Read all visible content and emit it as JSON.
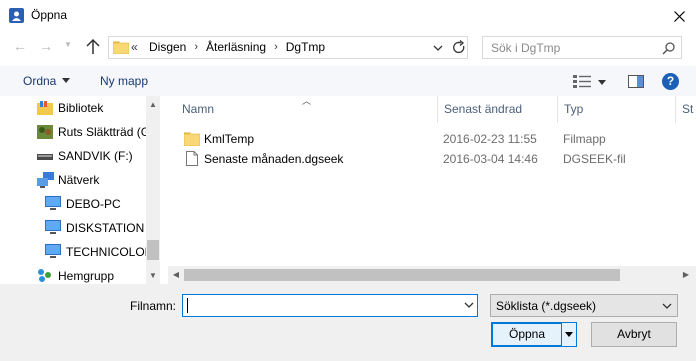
{
  "window": {
    "title": "Öppna"
  },
  "address": {
    "overflow": "«",
    "crumbs": [
      "Disgen",
      "Återläsning",
      "DgTmp"
    ]
  },
  "search": {
    "placeholder": "Sök i DgTmp"
  },
  "toolbar": {
    "organize_label": "Ordna",
    "new_folder_label": "Ny mapp"
  },
  "navigation": {
    "items": [
      {
        "label": "Bibliotek",
        "icon": "library-icon"
      },
      {
        "label": "Ruts Släktträd (G",
        "icon": "drive-icon"
      },
      {
        "label": "SANDVIK (F:)",
        "icon": "usb-drive-icon"
      },
      {
        "label": "Nätverk",
        "icon": "network-icon"
      },
      {
        "label": "DEBO-PC",
        "icon": "computer-icon"
      },
      {
        "label": "DISKSTATION",
        "icon": "computer-icon"
      },
      {
        "label": "TECHNICOLOR",
        "icon": "computer-icon"
      },
      {
        "label": "Hemgrupp",
        "icon": "homegroup-icon"
      }
    ]
  },
  "filelist": {
    "columns": [
      "Namn",
      "Senast ändrad",
      "Typ",
      "St"
    ],
    "rows": [
      {
        "name": "KmlTemp",
        "modified": "2016-02-23 11:55",
        "type": "Filmapp",
        "icon": "folder-icon"
      },
      {
        "name": "Senaste månaden.dgseek",
        "modified": "2016-03-04 14:46",
        "type": "DGSEEK-fil",
        "icon": "file-icon"
      }
    ]
  },
  "bottom": {
    "filename_label": "Filnamn:",
    "filename_value": "",
    "filetype_value": "Söklista (*.dgseek)",
    "open_label": "Öppna",
    "cancel_label": "Avbryt"
  },
  "colors": {
    "accent": "#0078d7",
    "help": "#1c5fb8",
    "folder": "#f3c94b"
  }
}
